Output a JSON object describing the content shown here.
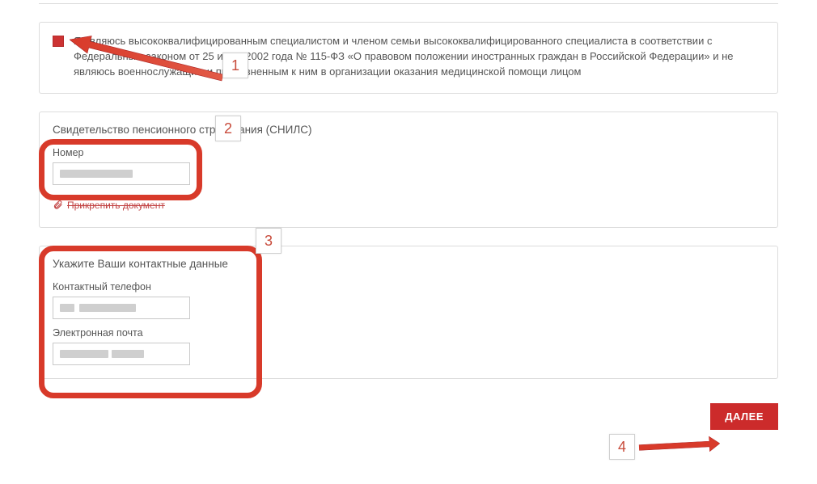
{
  "declaration": {
    "text": "Я являюсь высококвалифицированным специалистом и членом семьи высококвалифицированного специалиста в соответствии с Федеральным законом от 25 июля 2002 года № 115-ФЗ «О правовом положении иностранных граждан в Российской Федерации»  и не являюсь военнослужащим и приравненным к ним в организации оказания медицинской помощи лицом"
  },
  "snils": {
    "title": "Свидетельство пенсионного страхования (СНИЛС)",
    "number_label": "Номер",
    "number_value": "",
    "attach_label": "Прикрепить документ"
  },
  "contacts": {
    "title": "Укажите Ваши контактные данные",
    "phone_label": "Контактный телефон",
    "phone_value": "",
    "email_label": "Электронная почта",
    "email_value": ""
  },
  "buttons": {
    "next": "ДАЛЕЕ"
  },
  "callouts": {
    "c1": "1",
    "c2": "2",
    "c3": "3",
    "c4": "4"
  },
  "colors": {
    "accent_red": "#cc2b2b",
    "highlight_red": "#d83a2a"
  }
}
